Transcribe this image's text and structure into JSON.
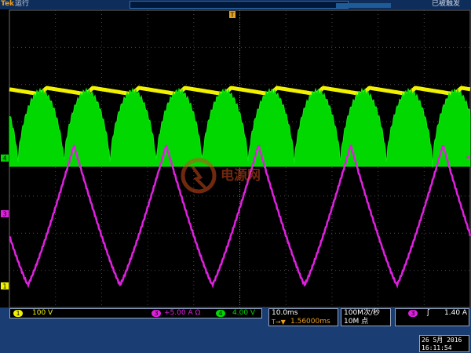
{
  "header": {
    "brand": "Tek",
    "run_state": "运行",
    "trigger_state": "已被触发"
  },
  "channels": {
    "ch1": {
      "label": "1",
      "scale": "100 V",
      "color": "#f2f200"
    },
    "ch3": {
      "label": "3",
      "scale": "5.00 A",
      "symbol": "Ω",
      "color": "#e020e0"
    },
    "ch4": {
      "label": "4",
      "scale": "4.00 V",
      "color": "#00d800"
    }
  },
  "markers": {
    "trigger_position": "T",
    "trigger_level": "◄",
    "ch1": "1",
    "ch3": "3",
    "ch4": "4"
  },
  "watermark": {
    "text": "电源网",
    "color": "#cc4a1c"
  },
  "timebase": {
    "scale": "10.0ms",
    "delay_icon": "T→▼",
    "delay": "1.56000ms"
  },
  "acquisition": {
    "sample_rate": "100M次/秒",
    "record_length": "10M 点"
  },
  "trigger": {
    "source": "3",
    "slope_icon": "rising-edge-icon",
    "slope_glyph": "ʃ",
    "level": "1.40 A"
  },
  "datetime": {
    "date": "26 5月  2016",
    "time": "16:11:54"
  }
}
